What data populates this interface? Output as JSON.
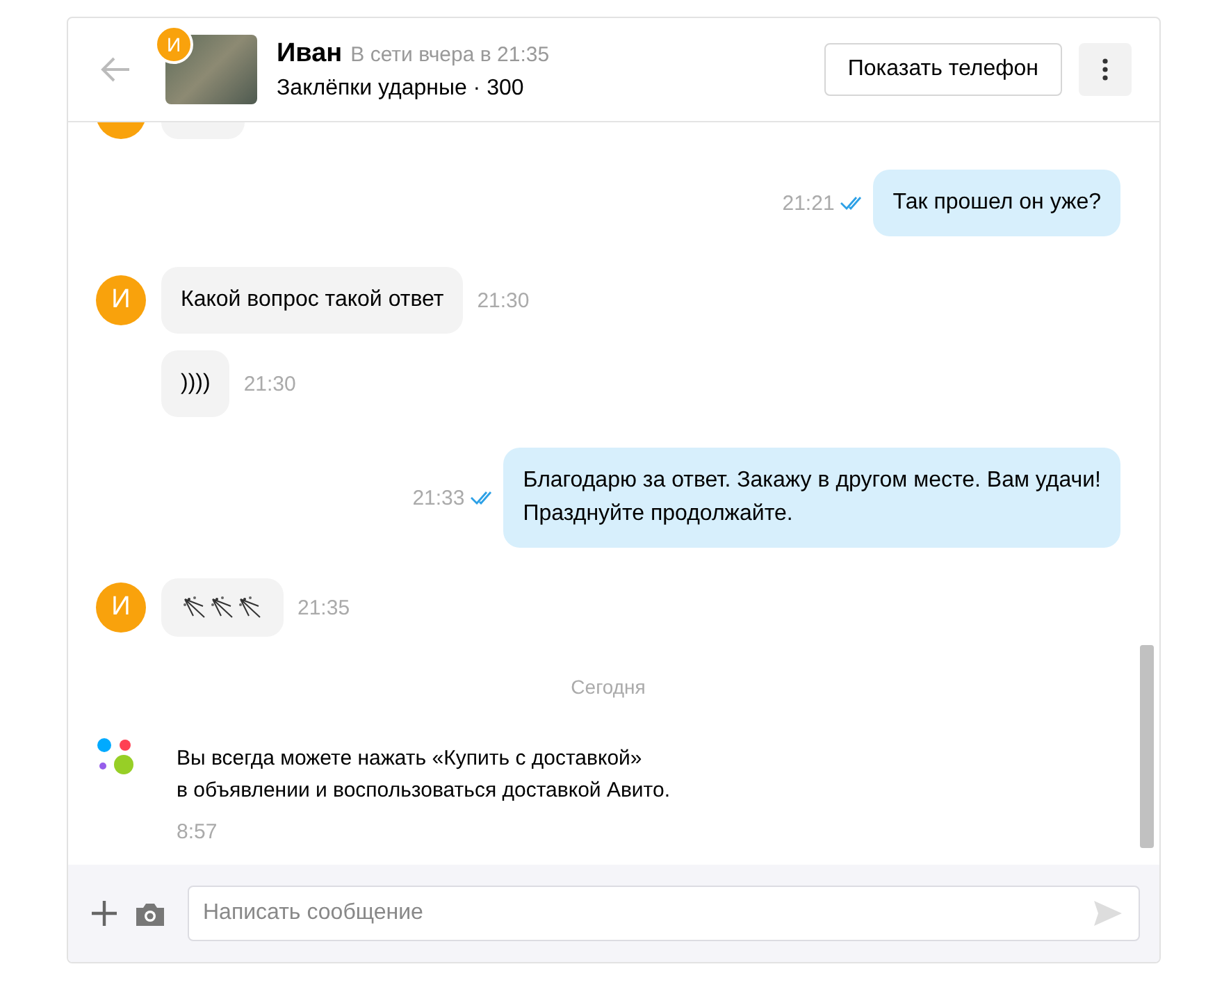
{
  "header": {
    "avatar_letter": "И",
    "name": "Иван",
    "status": "В сети вчера в 21:35",
    "listing": "Заклёпки ударные · 300",
    "phone_button": "Показать телефон"
  },
  "messages": [
    {
      "kind": "outgoing",
      "text": "Так прошел он уже?",
      "time": "21:21",
      "read": true
    },
    {
      "kind": "incoming",
      "avatar": true,
      "avatar_letter": "И",
      "text": "Какой вопрос такой ответ",
      "time": "21:30"
    },
    {
      "kind": "incoming",
      "avatar": false,
      "text": "))))",
      "time": "21:30"
    },
    {
      "kind": "outgoing",
      "text": "Благодарю за ответ. Закажу в другом месте. Вам удачи!\nПразднуйте продолжайте.",
      "time": "21:33",
      "read": true
    },
    {
      "kind": "stickers",
      "avatar": true,
      "avatar_letter": "И",
      "time": "21:35"
    },
    {
      "kind": "date",
      "text": "Сегодня"
    },
    {
      "kind": "system",
      "text": "Вы всегда можете нажать «Купить с доставкой»\nв объявлении и воспользоваться доставкой Авито.",
      "time": "8:57"
    }
  ],
  "composer": {
    "placeholder": "Написать сообщение"
  }
}
